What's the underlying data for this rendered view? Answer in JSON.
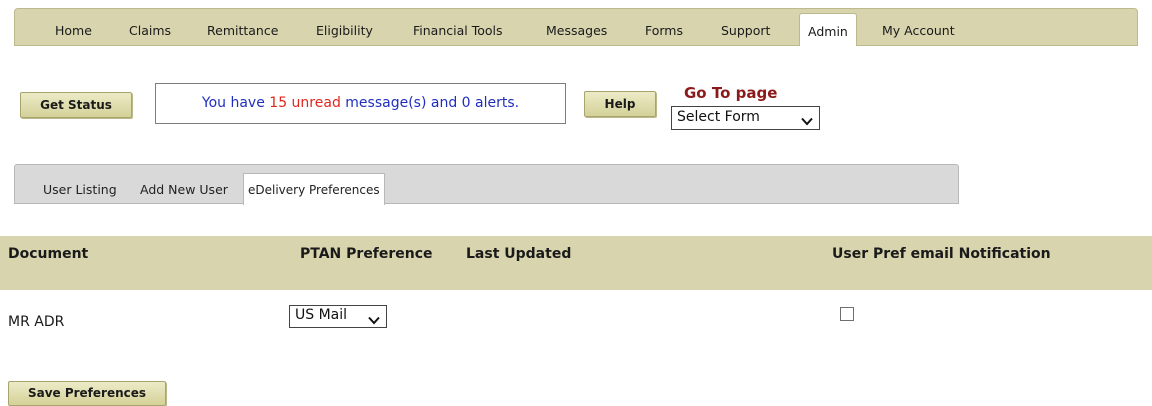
{
  "nav": {
    "items": [
      "Home",
      "Claims",
      "Remittance",
      "Eligibility",
      "Financial Tools",
      "Messages",
      "Forms",
      "Support",
      "Admin",
      "My Account"
    ],
    "active": "Admin"
  },
  "toolbar": {
    "get_status_label": "Get Status",
    "help_label": "Help",
    "message": {
      "prefix": "You have ",
      "count": "15",
      "unread_word": " unread",
      "suffix": " message(s) and 0 alerts."
    },
    "goto_title": "Go To page",
    "goto_select_value": "Select Form"
  },
  "subtabs": {
    "items": [
      "User Listing",
      "Add New User",
      "eDelivery Preferences"
    ],
    "active": "eDelivery Preferences"
  },
  "table": {
    "headers": {
      "document": "Document",
      "ptan": "PTAN Preference",
      "updated": "Last Updated",
      "notify": "User Pref email Notification"
    },
    "rows": [
      {
        "document": "MR ADR",
        "ptan": "US Mail",
        "updated": "",
        "notify_checked": false
      }
    ]
  },
  "save_label": "Save Preferences",
  "colors": {
    "nav_bg": "#d7d4ae",
    "message_text": "#1f2fbd",
    "message_highlight": "#e0261e",
    "goto_title": "#8b1a1a"
  },
  "icons": {
    "select_caret": "chevron-down-icon"
  }
}
